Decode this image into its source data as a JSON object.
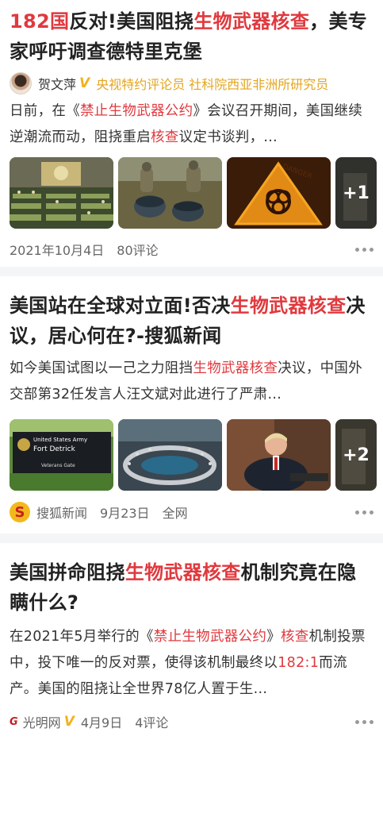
{
  "cards": [
    {
      "title_parts": [
        {
          "text": "182国",
          "hl": true
        },
        {
          "text": "反对!美国阻挠",
          "hl": false
        },
        {
          "text": "生物武器核查",
          "hl": true
        },
        {
          "text": "，美专家呼吁调查德特里克堡",
          "hl": false
        }
      ],
      "author": {
        "name": "贺文萍",
        "verified_mark": "V",
        "desc": "央视特约评论员 社科院西亚非洲所研究员"
      },
      "summary_parts": [
        {
          "text": "日前，在《",
          "hl": false
        },
        {
          "text": "禁止生物武器公约",
          "hl": true
        },
        {
          "text": "》会议召开期间，美国继续逆潮流而动，阻挠重启",
          "hl": false
        },
        {
          "text": "核查",
          "hl": true
        },
        {
          "text": "议定书谈判，...",
          "hl": false
        }
      ],
      "thumbnails": [
        "un-assembly-hall",
        "soldiers-barrels",
        "biohazard-sign",
        "more"
      ],
      "more_count": "+1",
      "meta": {
        "date": "2021年10月4日",
        "comments": "80评论"
      }
    },
    {
      "title_parts": [
        {
          "text": "美国站在全球对立面!否决",
          "hl": false
        },
        {
          "text": "生物武器核查",
          "hl": true
        },
        {
          "text": "决议，居心何在?-搜狐新闻",
          "hl": false
        }
      ],
      "summary_parts": [
        {
          "text": "如今美国试图以一己之力阻挡",
          "hl": false
        },
        {
          "text": "生物武器核查",
          "hl": true
        },
        {
          "text": "决议，中国外交部第32任发言人汪文斌对此进行了严肃...",
          "hl": false
        }
      ],
      "thumbnails": [
        "fort-detrick-sign",
        "un-security-council",
        "trump-signing",
        "more"
      ],
      "fort_sign": {
        "line1": "United States Army",
        "line2": "Fort Detrick",
        "line3": "Veterans Gate"
      },
      "more_count": "+2",
      "meta": {
        "source": "搜狐新闻",
        "date": "9月23日",
        "scope": "全网"
      }
    },
    {
      "title_parts": [
        {
          "text": "美国拼命阻挠",
          "hl": false
        },
        {
          "text": "生物武器核查",
          "hl": true
        },
        {
          "text": "机制究竟在隐瞒什么?",
          "hl": false
        }
      ],
      "summary_parts": [
        {
          "text": "在2021年5月举行的《",
          "hl": false
        },
        {
          "text": "禁止生物武器公约",
          "hl": true
        },
        {
          "text": "》",
          "hl": false
        },
        {
          "text": "核查",
          "hl": true
        },
        {
          "text": "机制投票中，投下唯一的反对票，使得该机制最终以",
          "hl": false
        },
        {
          "text": "182:1",
          "hl": true
        },
        {
          "text": "而流产。美国的阻挠让全世界78亿人置于生...",
          "hl": false
        }
      ],
      "meta": {
        "source": "光明网",
        "verified_mark": "V",
        "date": "4月9日",
        "comments": "4评论"
      }
    }
  ],
  "colors": {
    "highlight": "#e0393e",
    "verified": "#f2b21b",
    "separator": "#f4f5f6"
  }
}
